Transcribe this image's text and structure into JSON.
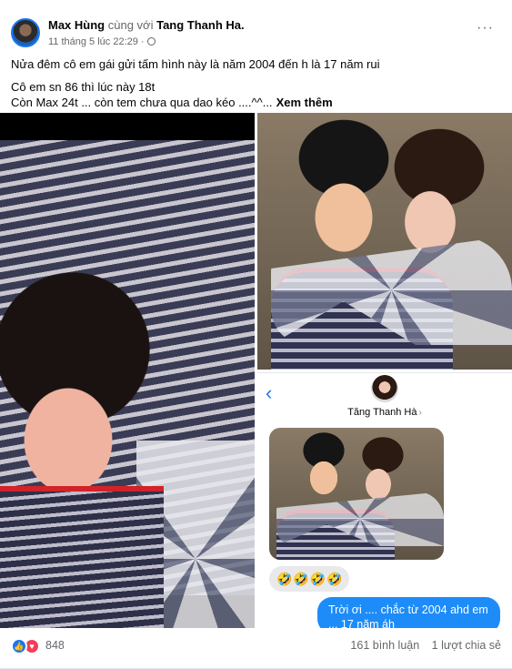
{
  "post": {
    "author": "Max Hùng",
    "with_text": "cùng với",
    "tagged": "Tang Thanh Ha.",
    "timestamp": "11 tháng 5 lúc 22:29 ·",
    "privacy_icon": "globe-icon",
    "more_icon": "···",
    "text_lines": [
      "Nửa đêm cô em gái gửi tấm hình này là năm 2004 đến h là 17 năm rui",
      "Cô em  sn 86 thì lúc này 18t",
      "Còn Max 24t ... còn tem chưa qua dao kéo ....^^..."
    ],
    "see_more": "Xem thêm"
  },
  "chat": {
    "back_icon": "‹",
    "contact_name": "Tăng Thanh Hà",
    "contact_arrow": "›",
    "emoji_reply": "🤣🤣🤣🤣",
    "sent_message": "Trời ơi .... chắc từ 2004 ahd em ... 17 năm áh"
  },
  "footer": {
    "like_icon": "👍",
    "love_icon": "♥",
    "reaction_count": "848",
    "comments": "161 bình luận",
    "shares": "1 lượt chia sẻ"
  }
}
